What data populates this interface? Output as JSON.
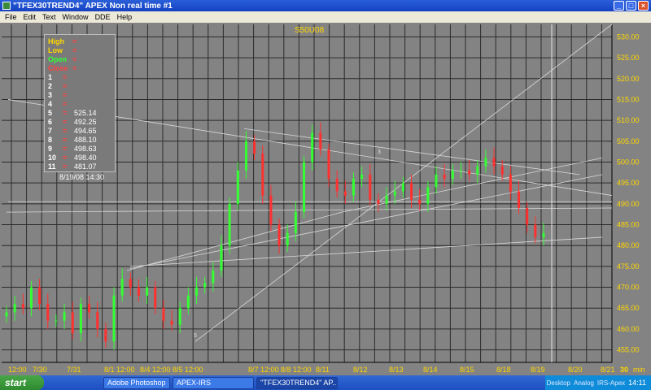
{
  "window": {
    "title": "\"TFEX30TREND4\" APEX Non real time #1"
  },
  "menu": [
    "File",
    "Edit",
    "Text",
    "Window",
    "DDE",
    "Help"
  ],
  "chart": {
    "symbol": "S50U08",
    "interval": "30",
    "interval_unit": "min"
  },
  "legend": {
    "rows": [
      {
        "key": "High",
        "val": "",
        "color": "#ffd700"
      },
      {
        "key": "Low",
        "val": "",
        "color": "#ffd700"
      },
      {
        "key": "Open",
        "val": "",
        "color": "#33ff33"
      },
      {
        "key": "Close",
        "val": "",
        "color": "#ff4040"
      },
      {
        "key": "1",
        "val": "",
        "color": "#ffffff"
      },
      {
        "key": "2",
        "val": "",
        "color": "#ffffff"
      },
      {
        "key": "3",
        "val": "",
        "color": "#ffffff"
      },
      {
        "key": "4",
        "val": "",
        "color": "#ffffff"
      },
      {
        "key": "5",
        "val": "525.14",
        "color": "#ffffff"
      },
      {
        "key": "6",
        "val": "492.25",
        "color": "#ffffff"
      },
      {
        "key": "7",
        "val": "494.65",
        "color": "#ffffff"
      },
      {
        "key": "8",
        "val": "488.10",
        "color": "#ffffff"
      },
      {
        "key": "9",
        "val": "498.63",
        "color": "#ffffff"
      },
      {
        "key": "10",
        "val": "498.40",
        "color": "#ffffff"
      },
      {
        "key": "11",
        "val": "481.07",
        "color": "#ffffff"
      }
    ],
    "datetime": "8/19/08  14:30"
  },
  "chart_data": {
    "type": "candlestick",
    "y_ticks": [
      "455.00",
      "460.00",
      "465.00",
      "470.00",
      "475.00",
      "480.00",
      "485.00",
      "490.00",
      "495.00",
      "500.00",
      "505.00",
      "510.00",
      "515.00",
      "520.00",
      "525.00",
      "530.00"
    ],
    "ylim": [
      452,
      533
    ],
    "x_ticks": [
      "12:00",
      "7/30",
      "7/31",
      "8/1 12:00",
      "8/4 12:00",
      "8/5 12:00",
      "8/7 12:00",
      "8/8 12:00",
      "8/11",
      "8/12",
      "8/13",
      "8/14",
      "8/15",
      "8/18",
      "8/19",
      "8/20",
      "8/21"
    ],
    "closes": [
      464,
      466,
      465,
      470,
      466,
      462,
      462,
      464,
      459,
      466,
      464,
      460,
      457,
      468,
      472,
      470,
      468,
      470,
      465,
      462,
      461,
      465,
      468,
      470,
      471,
      474,
      480,
      490,
      498,
      505,
      502,
      492,
      485,
      480,
      483,
      488,
      500,
      507,
      503,
      496,
      493,
      492,
      496,
      497,
      491,
      490,
      492,
      493,
      495,
      491,
      490,
      494,
      497,
      496,
      498,
      498,
      497,
      499,
      501,
      499,
      497,
      493,
      489,
      485,
      482,
      483
    ],
    "trendlines_y": [
      515.0,
      504.0,
      490.5,
      488.0,
      482.0,
      532.0
    ],
    "trendline_labels": [
      "5",
      "3"
    ]
  },
  "taskbar": {
    "start": "start",
    "tasks": [
      "Adobe Photoshop",
      "APEX-IRS",
      "\"TFEX30TREND4\" AP..."
    ],
    "tray": [
      "Desktop",
      "Analog",
      "IRS-Apex"
    ],
    "clock": "14:11"
  },
  "colors": {
    "up": "#33ff33",
    "down": "#ff3030",
    "background": "#838383",
    "grid": "#2b2b2b"
  }
}
